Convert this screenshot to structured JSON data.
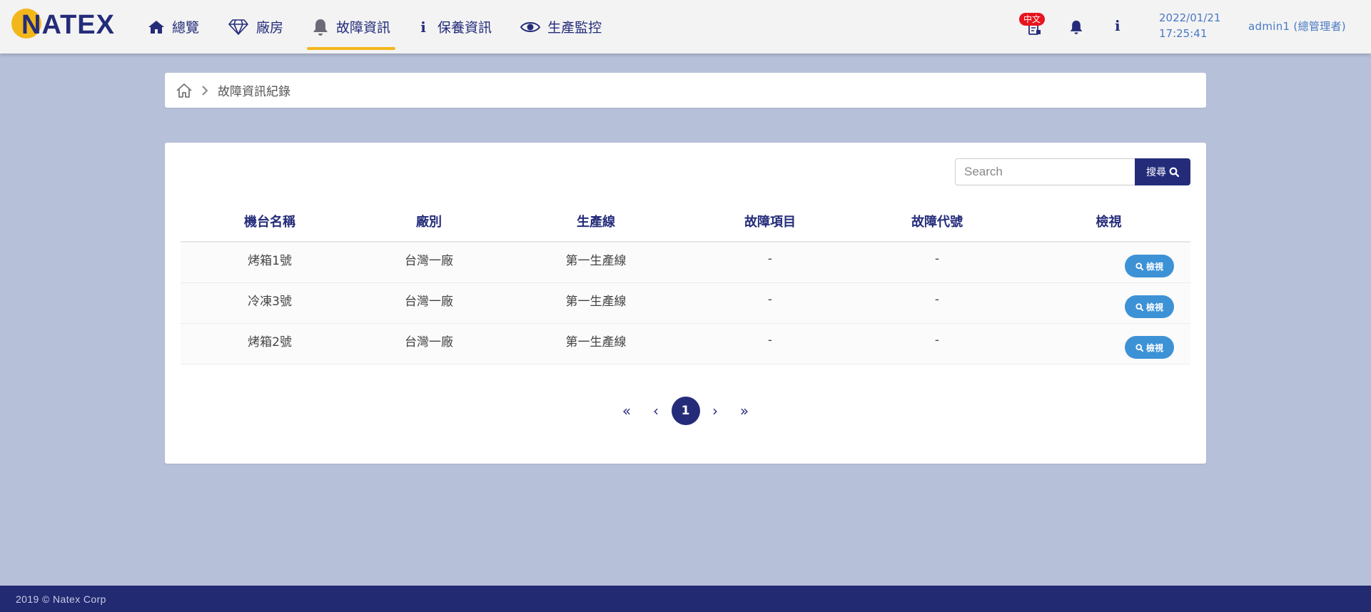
{
  "header": {
    "logo": "NATEX",
    "nav": [
      {
        "label": "總覽",
        "icon": "home-icon"
      },
      {
        "label": "廠房",
        "icon": "diamond-icon"
      },
      {
        "label": "故障資訊",
        "icon": "bell-icon",
        "active": true
      },
      {
        "label": "保養資訊",
        "icon": "info-icon"
      },
      {
        "label": "生產監控",
        "icon": "eye-icon"
      }
    ],
    "language_badge": "中文",
    "date": "2022/01/21",
    "time": "17:25:41",
    "user": "admin1 (總管理者)"
  },
  "breadcrumb": {
    "current": "故障資訊紀錄"
  },
  "search": {
    "placeholder": "Search",
    "button_label": "搜尋"
  },
  "table": {
    "columns": [
      "機台名稱",
      "廠別",
      "生產線",
      "故障項目",
      "故障代號",
      "檢視"
    ],
    "rows": [
      {
        "machine": "烤箱1號",
        "factory": "台灣一廠",
        "line": "第一生產線",
        "fault_item": "-",
        "fault_code": "-",
        "view_label": "檢視"
      },
      {
        "machine": "冷凍3號",
        "factory": "台灣一廠",
        "line": "第一生產線",
        "fault_item": "-",
        "fault_code": "-",
        "view_label": "檢視"
      },
      {
        "machine": "烤箱2號",
        "factory": "台灣一廠",
        "line": "第一生產線",
        "fault_item": "-",
        "fault_code": "-",
        "view_label": "檢視"
      }
    ]
  },
  "pagination": {
    "first": "«",
    "prev": "‹",
    "current": "1",
    "next": "›",
    "last": "»"
  },
  "footer": {
    "copyright": "2019 © Natex Corp"
  },
  "colors": {
    "primary": "#242c7a",
    "accent": "#f2b71b",
    "view_button": "#3d92d6",
    "page_background": "#b7c0d9",
    "badge": "#e8141e"
  }
}
